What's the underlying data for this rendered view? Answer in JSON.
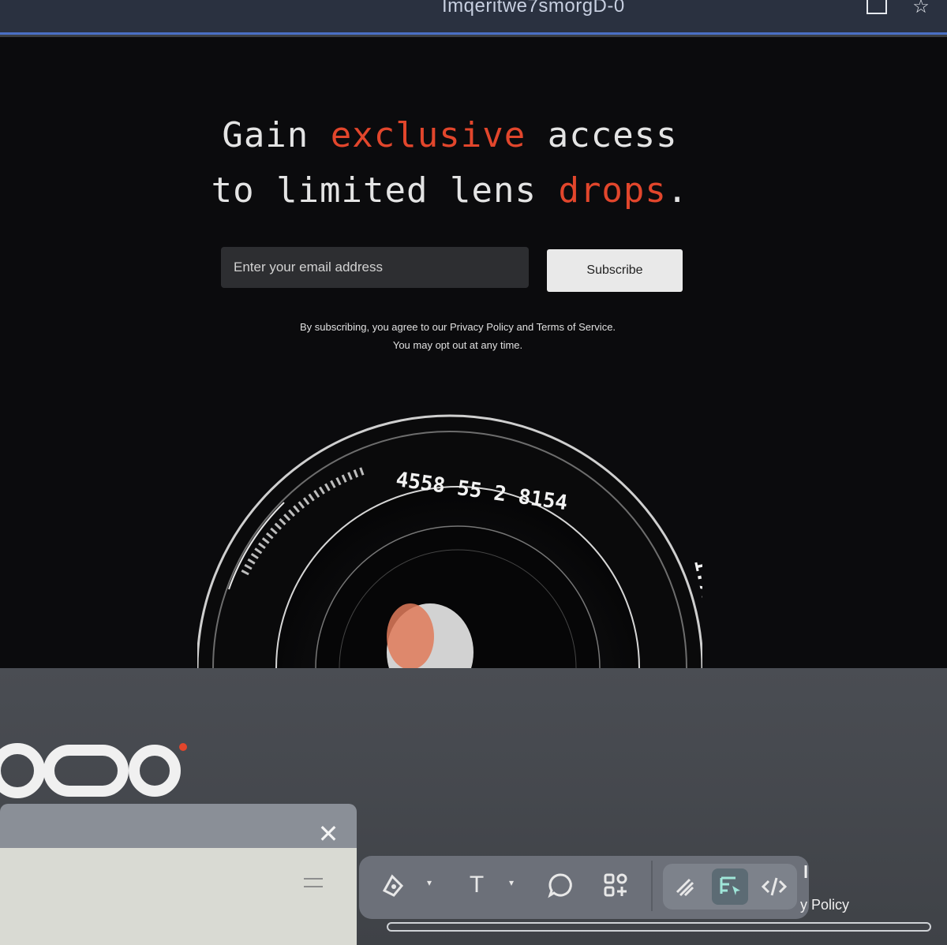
{
  "browser": {
    "url_fragment": "Imqeritwe7smorgD-0",
    "tab_icon": "tab-icon",
    "bookmark_icon": "star-icon"
  },
  "hero": {
    "headline": {
      "w1": "Gain",
      "w2": "exclusive",
      "w3": "access",
      "w4": "to limited lens",
      "w5": "drops",
      "w6": "."
    },
    "email_placeholder": "Enter your email address",
    "subscribe_label": "Subscribe",
    "legal_line1_a": "By subscribing, you agree to our ",
    "legal_privacy": "Privacy Policy",
    "legal_and": " and ",
    "legal_terms": "Terms of Service.",
    "legal_line2": "You may opt out at any time.",
    "accent_color": "#e2462c"
  },
  "lens": {
    "ring_text_top": "4558 55 2 8154",
    "ring_text_side": "1.71 2.8 1.0:00"
  },
  "editor": {
    "close_icon": "close-icon",
    "toolbar": {
      "tools": [
        "pen-tool-icon",
        "text-tool-icon",
        "comment-icon",
        "add-component-icon",
        "draw-icon",
        "inspect-icon",
        "code-icon"
      ],
      "text_tool_glyph": "T"
    },
    "side_text": "y Policy",
    "side_mark": "l"
  }
}
